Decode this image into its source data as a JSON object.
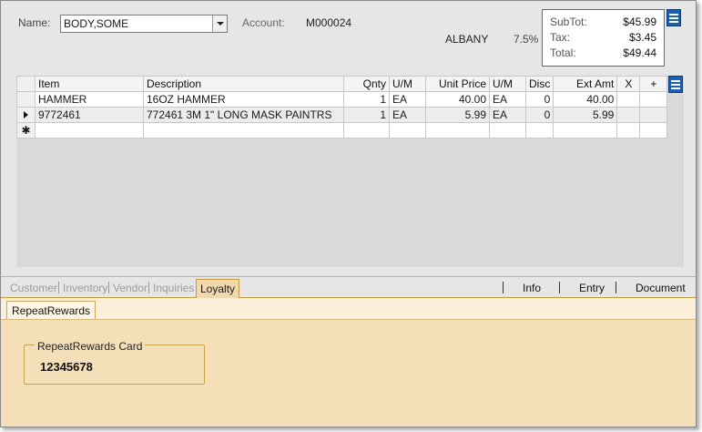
{
  "header": {
    "name_label": "Name:",
    "name_value": "BODY,SOME",
    "account_label": "Account:",
    "account_value": "M000024",
    "city": "ALBANY",
    "tax_rate": "7.5%"
  },
  "totals": {
    "subtotal_label": "SubTot:",
    "subtotal_value": "$45.99",
    "tax_label": "Tax:",
    "tax_value": "$3.45",
    "total_label": "Total:",
    "total_value": "$49.44"
  },
  "grid": {
    "columns": [
      "Item",
      "Description",
      "Qnty",
      "U/M",
      "Unit Price",
      "U/M",
      "Disc",
      "Ext Amt",
      "X",
      "+"
    ],
    "rows": [
      [
        "HAMMER",
        "16OZ HAMMER",
        "1",
        "EA",
        "40.00",
        "EA",
        "0",
        "40.00",
        "",
        ""
      ],
      [
        "9772461",
        "772461 3M 1\" LONG MASK PAINTRS",
        "1",
        "EA",
        "5.99",
        "EA",
        "0",
        "5.99",
        "",
        ""
      ]
    ]
  },
  "tabs": {
    "left": [
      "Customer",
      "Inventory",
      "Vendor",
      "Inquiries",
      "Loyalty"
    ],
    "right": [
      "Info",
      "Entry",
      "Document"
    ]
  },
  "loyalty": {
    "subtab": "RepeatRewards",
    "card_legend": "RepeatRewards Card",
    "card_number": "12345678"
  },
  "icons": {
    "menu": "hamburger-menu-icon",
    "current_row": "row-pointer-icon",
    "new_row": "new-row-star-icon"
  },
  "colors": {
    "menu_button": "#1a5fb4",
    "panel_background": "#f5dfb9",
    "active_tab_border": "#c79a3a"
  }
}
